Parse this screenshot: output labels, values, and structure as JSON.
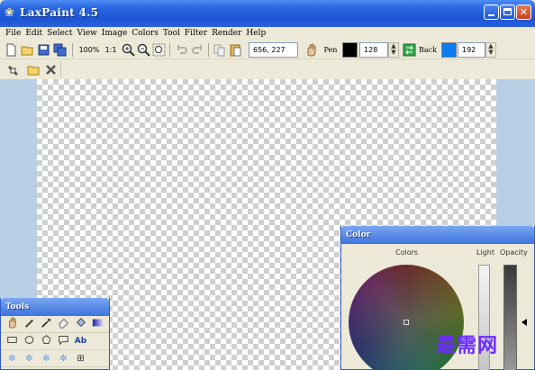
{
  "window": {
    "title": "LaxPaint 4.5"
  },
  "menu": [
    "File",
    "Edit",
    "Select",
    "View",
    "Image",
    "Colors",
    "Tool",
    "Filter",
    "Render",
    "Help"
  ],
  "toolbar": {
    "zoom_percent": "100%",
    "zoom_actual": "1:1",
    "coords": "656, 227",
    "pen_label": "Pen",
    "pen_color": "#000000",
    "pen_value": "128",
    "back_label": "Back",
    "back_color": "#0a7bf0",
    "back_value": "192"
  },
  "tools_panel": {
    "title": "Tools",
    "text_tool_label": "Ab"
  },
  "color_panel": {
    "title": "Color",
    "colors_label": "Colors",
    "light_label": "Light",
    "opacity_label": "Opacity"
  },
  "watermark": "最需网"
}
